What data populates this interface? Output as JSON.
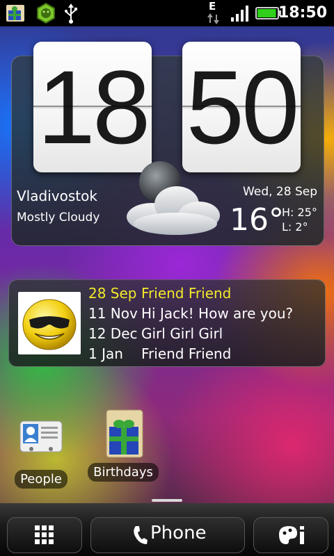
{
  "status_bar": {
    "time": "18:50",
    "network": "E",
    "icons": [
      "birthdays-icon",
      "lion-icon",
      "usb-icon",
      "data-arrows-icon",
      "signal-icon",
      "battery-icon"
    ],
    "battery_level": 0.95,
    "signal_level": 1.0
  },
  "clock_widget": {
    "hours": "18",
    "minutes": "50",
    "city": "Vladivostok",
    "condition": "Mostly Cloudy",
    "date": "Wed, 28 Sep",
    "temperature": "16°",
    "high": "H: 25°",
    "low": "L:   2°",
    "weather_icon": "night-cloudy-icon"
  },
  "birthday_widget": {
    "avatar_icon": "smiley-sunglasses-icon",
    "highlight_color": "#f2ea2a",
    "entries": [
      {
        "date": "28 Sep",
        "name": "Friend Friend"
      },
      {
        "date": "11 Nov",
        "name": "Hi Jack! How are you?"
      },
      {
        "date": "12 Dec",
        "name": "Girl Girl Girl"
      },
      {
        "date": "1 Jan",
        "name": "Friend Friend"
      }
    ]
  },
  "shortcuts": [
    {
      "label": "People",
      "icon": "contact-card-icon"
    },
    {
      "label": "Birthdays",
      "icon": "gift-scroll-icon"
    }
  ],
  "dock": {
    "phone_label": "Phone",
    "left_icon": "app-grid-icon",
    "right_icon": "personalize-icon"
  }
}
